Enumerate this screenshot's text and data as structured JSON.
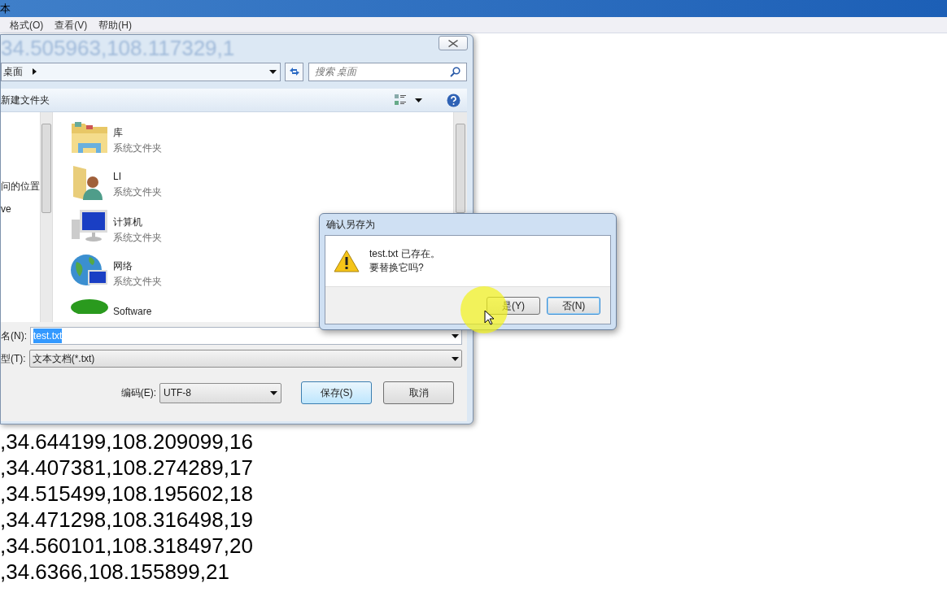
{
  "notepad": {
    "title": "本",
    "menu": [
      "格式(O)",
      "查看(V)",
      "帮助(H)"
    ],
    "lines": [
      ",34.644199,108.209099,16",
      ",34.407381,108.274289,17",
      ",34.515499,108.195602,18",
      ",34.471298,108.316498,19",
      ",34.560101,108.318497,20",
      ",34.6366,108.155899,21"
    ]
  },
  "save_dialog": {
    "background_text": "34.505963,108.117329,1",
    "breadcrumb": "桌面",
    "search_placeholder": "搜索 桌面",
    "new_folder": "新建文件夹",
    "nav_items": [
      "问的位置",
      "ve"
    ],
    "items": [
      {
        "kind": "library",
        "name": "库",
        "subtitle": "系统文件夹"
      },
      {
        "kind": "user",
        "name": "LI",
        "subtitle": "系统文件夹"
      },
      {
        "kind": "computer",
        "name": "计算机",
        "subtitle": "系统文件夹"
      },
      {
        "kind": "network",
        "name": "网络",
        "subtitle": "系统文件夹"
      },
      {
        "kind": "software",
        "name": "Software"
      }
    ],
    "filename_label": "名(N):",
    "filename": {
      "value": "test.txt",
      "selected": true
    },
    "type_label": "型(T):",
    "type": "文本文档(*.txt)",
    "encoding_label": "编码(E):",
    "encoding": "UTF-8",
    "buttons": [
      {
        "label": "保存(S)",
        "default": true
      },
      {
        "label": "取消",
        "default": false
      }
    ]
  },
  "confirm": {
    "title": "确认另存为",
    "message": [
      "test.txt 已存在。",
      "要替换它吗?"
    ],
    "buttons": [
      {
        "label": "是(Y)",
        "focused": false
      },
      {
        "label": "否(N)",
        "focused": true
      }
    ]
  }
}
